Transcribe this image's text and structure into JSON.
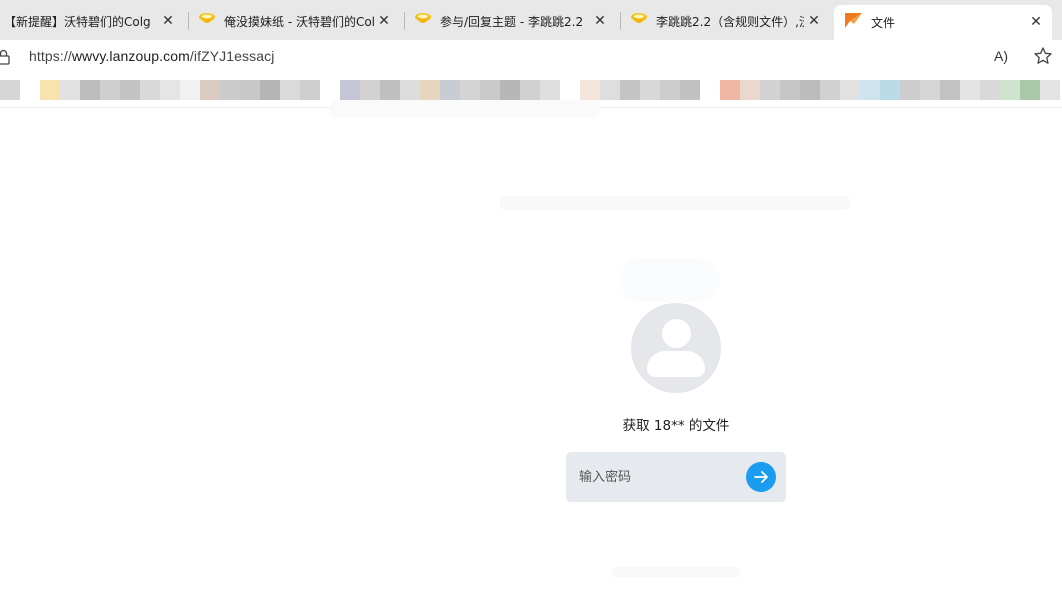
{
  "tabs": [
    {
      "title": "【新提醒】沃特碧们的Colg - ",
      "close": "✕"
    },
    {
      "title": "俺没摸妹纸 - 沃特碧们的Col",
      "close": "✕"
    },
    {
      "title": "参与/回复主题 - 李跳跳2.2（",
      "close": "✕"
    },
    {
      "title": "李跳跳2.2（含规则文件）,沃",
      "close": "✕"
    },
    {
      "title": "文件",
      "close": "✕"
    }
  ],
  "address_bar": {
    "scheme": "https://",
    "host": "wwvy.lanzoup.com",
    "path": "/ifZYJ1essacj",
    "read_aloud": "A)"
  },
  "page": {
    "file_label": "获取 18** 的文件",
    "password_placeholder": "输入密码"
  },
  "colors": {
    "accent": "#1a9cf0",
    "tabstrip": "#e8e8e8",
    "input_bg": "#e6e9ee"
  }
}
